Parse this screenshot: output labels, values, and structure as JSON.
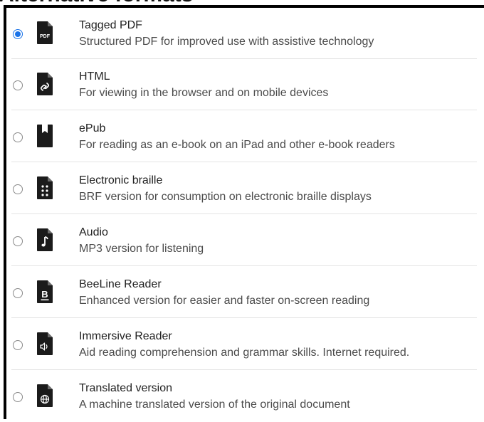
{
  "heading": "Alternative formats",
  "options": [
    {
      "title": "Tagged PDF",
      "description": "Structured PDF for improved use with assistive technology",
      "checked": true,
      "icon": "pdf-file-icon",
      "icon_text": "PDF"
    },
    {
      "title": "HTML",
      "description": "For viewing in the browser and on mobile devices",
      "checked": false,
      "icon": "html-link-file-icon"
    },
    {
      "title": "ePub",
      "description": "For reading as an e-book on an iPad and other e-book readers",
      "checked": false,
      "icon": "epub-bookmark-icon"
    },
    {
      "title": "Electronic braille",
      "description": "BRF version for consumption on electronic braille displays",
      "checked": false,
      "icon": "braille-file-icon"
    },
    {
      "title": "Audio",
      "description": "MP3 version for listening",
      "checked": false,
      "icon": "audio-file-icon"
    },
    {
      "title": "BeeLine Reader",
      "description": "Enhanced version for easier and faster on-screen reading",
      "checked": false,
      "icon": "beeline-file-icon",
      "icon_text": "B"
    },
    {
      "title": "Immersive Reader",
      "description": "Aid reading comprehension and grammar skills. Internet required.",
      "checked": false,
      "icon": "immersive-reader-file-icon"
    },
    {
      "title": "Translated version",
      "description": "A machine translated version of the original document",
      "checked": false,
      "icon": "globe-file-icon"
    }
  ],
  "colors": {
    "accent": "#1a73e8",
    "icon": "#1b1b1b",
    "separator": "#e3e3e3"
  }
}
